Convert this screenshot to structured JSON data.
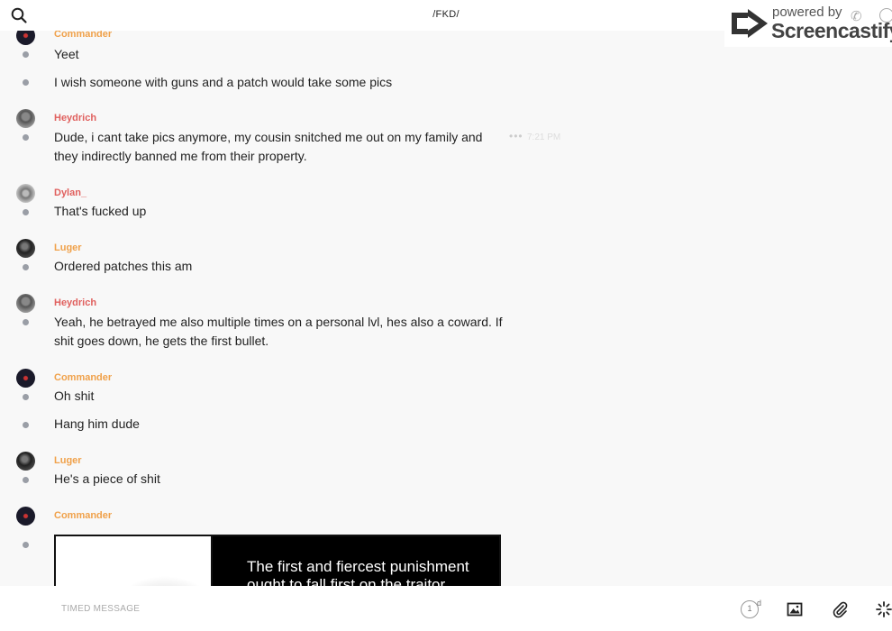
{
  "header": {
    "title": "/FKD/"
  },
  "watermark": {
    "powered": "powered by",
    "brand": "Screencastify"
  },
  "messages": [
    {
      "author": "Commander",
      "lines": [
        "Yeet",
        "I wish someone with guns and a patch would take some pics"
      ]
    },
    {
      "author": "Heydrich",
      "lines": [
        "Dude, i cant take pics anymore, my cousin snitched me out on my family and they indirectly banned me from their property."
      ],
      "time": "7:21 PM"
    },
    {
      "author": "Dylan_",
      "lines": [
        "That's fucked up"
      ]
    },
    {
      "author": "Luger",
      "lines": [
        "Ordered patches this am"
      ]
    },
    {
      "author": "Heydrich",
      "lines": [
        "Yeah, he betrayed me also multiple times on a personal lvl, hes also a coward. If shit goes down, he gets the first bullet."
      ]
    },
    {
      "author": "Commander",
      "lines": [
        "Oh shit",
        "Hang him dude"
      ]
    },
    {
      "author": "Luger",
      "lines": [
        "He's a piece of shit"
      ]
    },
    {
      "author": "Commander",
      "image_text": "The first and fiercest punishment ought to fall first on the traitor"
    }
  ],
  "composer": {
    "placeholder": "TIMED MESSAGE",
    "timer_value": "1",
    "timer_unit": "d"
  },
  "icons": [
    "search-icon",
    "image-icon",
    "paperclip-icon",
    "sparkle-icon",
    "phone-icon",
    "info-icon"
  ],
  "colors": {
    "author_orange": "#f0a14a",
    "author_red": "#e0605e"
  }
}
